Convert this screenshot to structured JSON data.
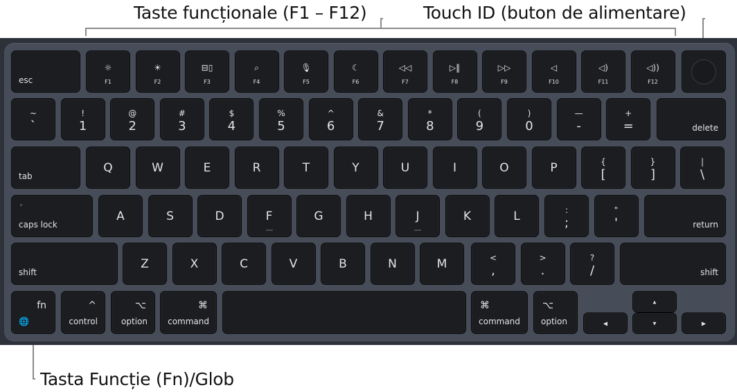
{
  "callouts": {
    "function_keys": "Taste funcționale (F1 – F12)",
    "touch_id": "Touch ID (buton de alimentare)",
    "fn_globe": "Tasta Funcție (Fn)/Glob"
  },
  "colors": {
    "frame": "#2d313a",
    "deck": "#464c58",
    "key": "#1c1d20",
    "key_text": "#e4e4e6",
    "callout_line": "#8a8a8a"
  },
  "row_fn": {
    "esc": "esc",
    "keys": [
      {
        "label": "F1",
        "icon": "☼",
        "icon_name": "brightness-down-icon"
      },
      {
        "label": "F2",
        "icon": "☀",
        "icon_name": "brightness-up-icon"
      },
      {
        "label": "F3",
        "icon": "⊟▯",
        "icon_name": "mission-control-icon"
      },
      {
        "label": "F4",
        "icon": "⌕",
        "icon_name": "spotlight-search-icon"
      },
      {
        "label": "F5",
        "icon": "🎙",
        "icon_name": "dictation-mic-icon"
      },
      {
        "label": "F6",
        "icon": "☾",
        "icon_name": "do-not-disturb-moon-icon"
      },
      {
        "label": "F7",
        "icon": "◁◁",
        "icon_name": "rewind-icon"
      },
      {
        "label": "F8",
        "icon": "▷‖",
        "icon_name": "play-pause-icon"
      },
      {
        "label": "F9",
        "icon": "▷▷",
        "icon_name": "fast-forward-icon"
      },
      {
        "label": "F10",
        "icon": "◁",
        "icon_name": "mute-icon"
      },
      {
        "label": "F11",
        "icon": "◁)",
        "icon_name": "volume-down-icon"
      },
      {
        "label": "F12",
        "icon": "◁))",
        "icon_name": "volume-up-icon"
      }
    ]
  },
  "row_num": {
    "keys": [
      {
        "top": "~",
        "bot": "`"
      },
      {
        "top": "!",
        "bot": "1"
      },
      {
        "top": "@",
        "bot": "2"
      },
      {
        "top": "#",
        "bot": "3"
      },
      {
        "top": "$",
        "bot": "4"
      },
      {
        "top": "%",
        "bot": "5"
      },
      {
        "top": "^",
        "bot": "6"
      },
      {
        "top": "&",
        "bot": "7"
      },
      {
        "top": "*",
        "bot": "8"
      },
      {
        "top": "(",
        "bot": "9"
      },
      {
        "top": ")",
        "bot": "0"
      },
      {
        "top": "—",
        "bot": "-"
      },
      {
        "top": "+",
        "bot": "="
      }
    ],
    "delete": "delete"
  },
  "row_q": {
    "tab": "tab",
    "letters": [
      "Q",
      "W",
      "E",
      "R",
      "T",
      "Y",
      "U",
      "I",
      "O",
      "P"
    ],
    "pairs": [
      {
        "top": "{",
        "bot": "["
      },
      {
        "top": "}",
        "bot": "]"
      },
      {
        "top": "|",
        "bot": "\\"
      }
    ]
  },
  "row_a": {
    "caps": "caps lock",
    "letters": [
      "A",
      "S",
      "D",
      "F",
      "G",
      "H",
      "J",
      "K",
      "L"
    ],
    "pairs": [
      {
        "top": ":",
        "bot": ";"
      },
      {
        "top": "\"",
        "bot": "'"
      }
    ],
    "return": "return"
  },
  "row_z": {
    "shift_left": "shift",
    "letters": [
      "Z",
      "X",
      "C",
      "V",
      "B",
      "N",
      "M"
    ],
    "pairs": [
      {
        "top": "<",
        "bot": ","
      },
      {
        "top": ">",
        "bot": "."
      },
      {
        "top": "?",
        "bot": "/"
      }
    ],
    "shift_right": "shift"
  },
  "row_bottom": {
    "fn": {
      "label": "fn",
      "icon": "🌐"
    },
    "control": {
      "label": "control",
      "symbol": "^"
    },
    "option_left": {
      "label": "option",
      "symbol": "⌥"
    },
    "command_left": {
      "label": "command",
      "symbol": "⌘"
    },
    "command_right": {
      "label": "command",
      "symbol": "⌘"
    },
    "option_right": {
      "label": "option",
      "symbol": "⌥"
    },
    "arrows": {
      "left": "◀",
      "up": "▲",
      "down": "▼",
      "right": "▶"
    }
  }
}
